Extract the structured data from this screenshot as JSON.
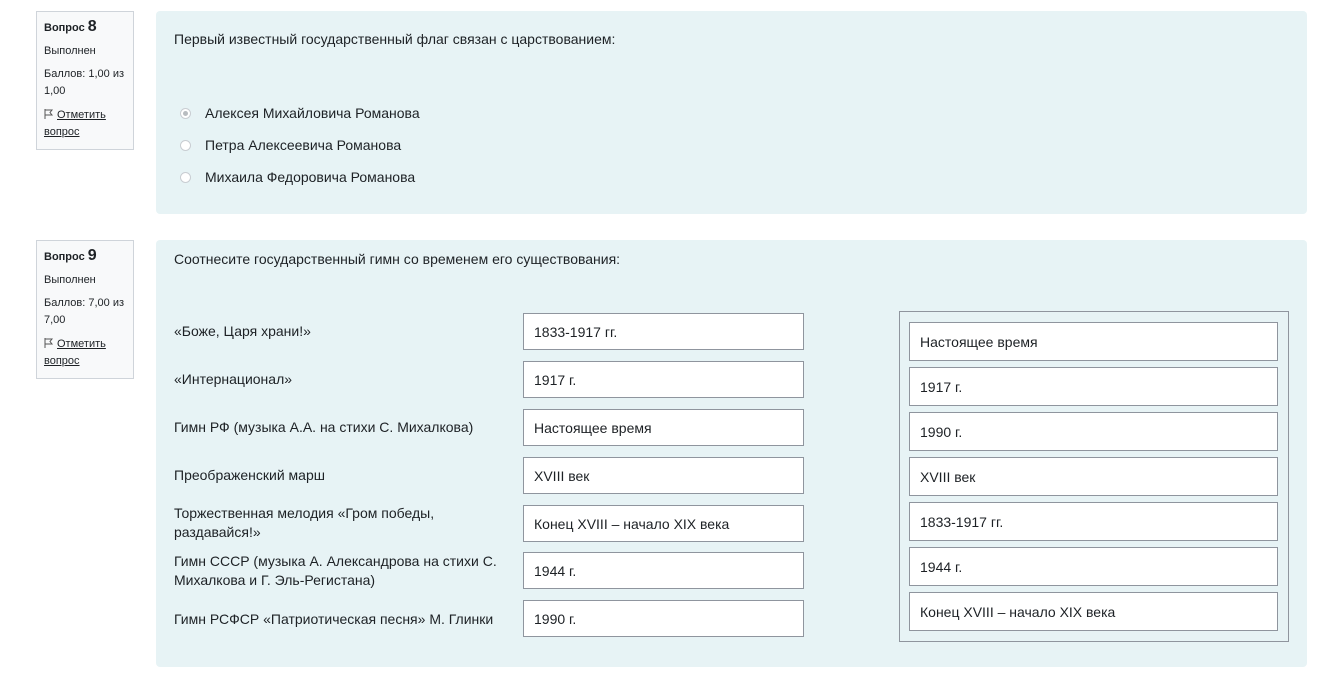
{
  "q8": {
    "label": "Вопрос",
    "number": "8",
    "state": "Выполнен",
    "grade": "Баллов: 1,00 из 1,00",
    "flag": "Отметить вопрос",
    "text": "Первый известный государственный флаг связан с царствованием:",
    "answers": [
      "Алексея Михайловича Романова",
      "Петра Алексеевича Романова",
      "Михаила Федоровича Романова"
    ]
  },
  "q9": {
    "label": "Вопрос",
    "number": "9",
    "state": "Выполнен",
    "grade": "Баллов: 7,00 из 7,00",
    "flag": "Отметить вопрос",
    "text": "Соотнесите государственный гимн со временем его существования:",
    "rows": [
      {
        "label": "«Боже, Царя храни!»",
        "value": "1833-1917 гг."
      },
      {
        "label": "«Интернационал»",
        "value": "1917 г."
      },
      {
        "label": "Гимн РФ (музыка А.А. на стихи С. Михалкова)",
        "value": "Настоящее время"
      },
      {
        "label": "Преображенский марш",
        "value": "XVIII век"
      },
      {
        "label": "Торжественная мелодия «Гром победы, раздавайся!»",
        "value": "Конец XVIII – начало XIX века"
      },
      {
        "label": "Гимн СССР (музыка А. Александрова на стихи С. Михалкова и Г. Эль-Регистана)",
        "value": "1944 г."
      },
      {
        "label": "Гимн РСФСР «Патриотическая песня» М. Глинки",
        "value": "1990 г."
      }
    ],
    "choices": [
      "Настоящее время",
      "1917 г.",
      "1990 г.",
      "XVIII век",
      "1833-1917 гг.",
      "1944 г.",
      "Конец XVIII – начало XIX века"
    ]
  }
}
